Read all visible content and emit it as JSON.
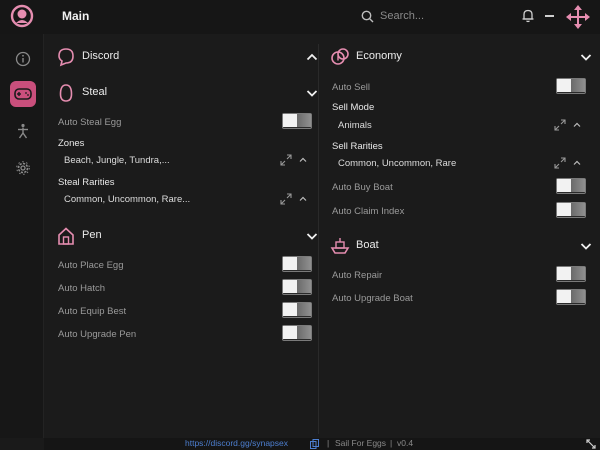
{
  "app": {
    "title": "Main"
  },
  "search": {
    "placeholder": "Search..."
  },
  "left": {
    "discord": {
      "title": "Discord"
    },
    "steal": {
      "title": "Steal",
      "auto_steal_egg": "Auto Steal Egg",
      "zones_label": "Zones",
      "zones_value": "Beach, Jungle, Tundra,...",
      "rarities_label": "Steal Rarities",
      "rarities_value": "Common, Uncommon, Rare..."
    },
    "pen": {
      "title": "Pen",
      "items": [
        "Auto Place Egg",
        "Auto Hatch",
        "Auto Equip Best",
        "Auto Upgrade Pen"
      ]
    }
  },
  "right": {
    "economy": {
      "title": "Economy",
      "auto_sell": "Auto Sell",
      "sell_mode_label": "Sell Mode",
      "sell_mode_value": "Animals",
      "sell_rarities_label": "Sell Rarities",
      "sell_rarities_value": "Common, Uncommon, Rare",
      "auto_buy_boat": "Auto Buy Boat",
      "auto_claim_index": "Auto Claim Index"
    },
    "boat": {
      "title": "Boat",
      "items": [
        "Auto Repair",
        "Auto Upgrade Boat"
      ]
    }
  },
  "toggles_state": "all off",
  "footer": {
    "link": "https://discord.gg/synapsex",
    "sep": "|",
    "game": "Sail For Eggs",
    "version": "v0.4"
  },
  "colors": {
    "accent": "#e58db0",
    "active_tab": "#c94f7c",
    "link": "#4d7fd0"
  },
  "icons": [
    "logo-icon",
    "search-icon",
    "bell-icon",
    "minimize-icon",
    "move-icon",
    "info-icon",
    "gamepad-icon",
    "figure-icon",
    "gear-icon",
    "discord-icon",
    "egg-icon",
    "house-icon",
    "coins-icon",
    "boat-icon",
    "chevron-up-icon",
    "chevron-down-icon",
    "expand-icon",
    "caret-up-icon",
    "copy-icon",
    "resize-icon"
  ]
}
